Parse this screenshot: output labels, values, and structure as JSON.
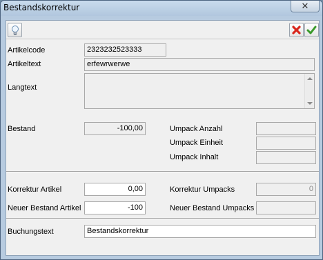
{
  "window": {
    "title": "Bestandskorrektur",
    "close_glyph": "✕"
  },
  "toolbar": {
    "hint_icon": "lightbulb-icon",
    "cancel_icon": "red-x-icon",
    "ok_icon": "green-check-icon"
  },
  "form": {
    "artikelcode_label": "Artikelcode",
    "artikelcode_value": "2323232523333",
    "artikeltext_label": "Artikeltext",
    "artikeltext_value": "erfewrwerwe",
    "langtext_label": "Langtext",
    "langtext_value": "",
    "bestand_label": "Bestand",
    "bestand_value": "-100,00",
    "umpack_anzahl_label": "Umpack Anzahl",
    "umpack_anzahl_value": "",
    "umpack_einheit_label": "Umpack Einheit",
    "umpack_einheit_value": "",
    "umpack_inhalt_label": "Umpack Inhalt",
    "umpack_inhalt_value": "",
    "korrektur_artikel_label": "Korrektur Artikel",
    "korrektur_artikel_value": "0,00",
    "korrektur_umpacks_label": "Korrektur Umpacks",
    "korrektur_umpacks_value": "0",
    "neuer_bestand_artikel_label": "Neuer Bestand Artikel",
    "neuer_bestand_artikel_value": "-100",
    "neuer_bestand_umpacks_label": "Neuer Bestand Umpacks",
    "neuer_bestand_umpacks_value": "",
    "buchungstext_label": "Buchungstext",
    "buchungstext_value": "Bestandskorrektur"
  },
  "colors": {
    "frame": "#b7cbe0",
    "client": "#f0f0f0",
    "cancel_red": "#d9261c",
    "ok_green": "#3a9a2a"
  }
}
